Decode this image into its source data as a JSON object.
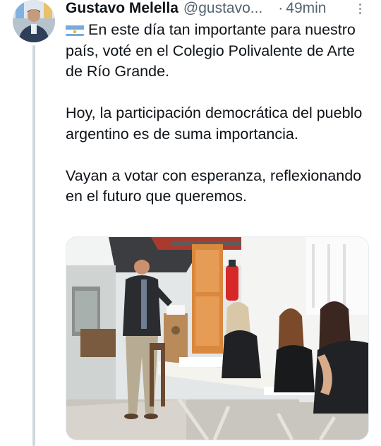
{
  "tweet": {
    "author_name": "Gustavo Melella",
    "author_handle": "@gustavo...",
    "separator": "·",
    "time": "49min",
    "flag_icon": "argentina-flag-icon",
    "paragraphs": [
      "En este día tan importante para nuestro país, voté en el Colegio Polivalente de Arte de Río Grande.",
      "Hoy, la participación democrática del pueblo argentino es de suma importancia.",
      "Vayan a votar con esperanza, reflexionando en el futuro que queremos."
    ]
  },
  "colors": {
    "text": "#0f1419",
    "secondary_text": "#536471",
    "thread_line": "#cfd9de"
  }
}
